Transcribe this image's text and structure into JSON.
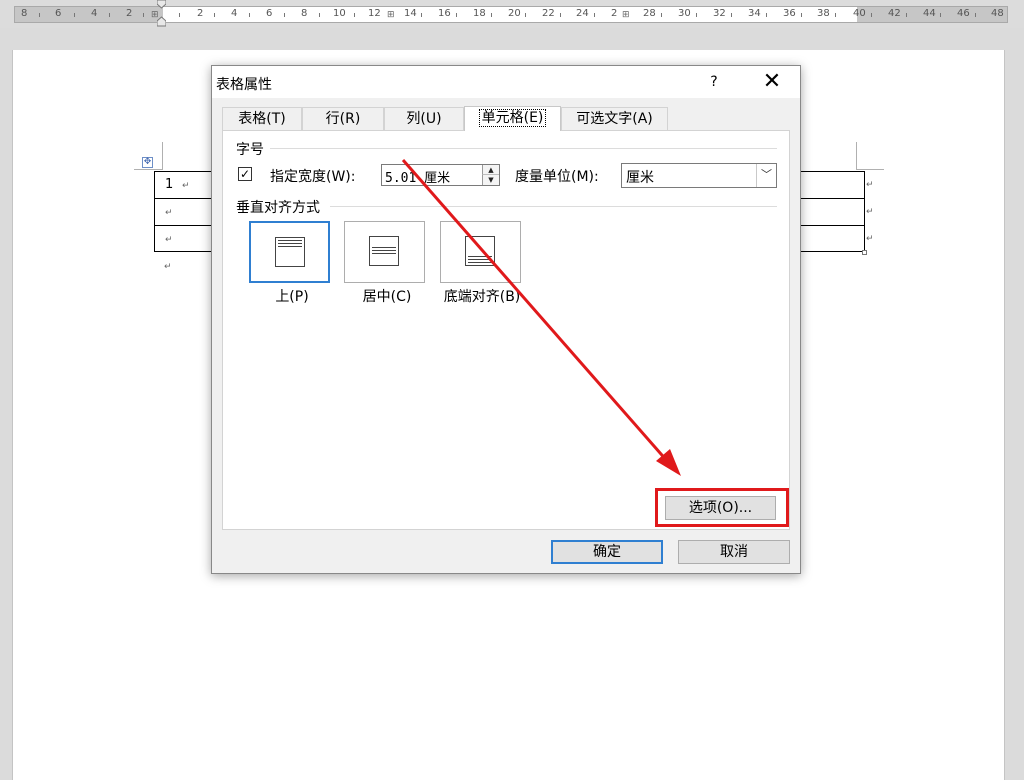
{
  "ruler": {
    "left_numbers": [
      "8",
      "6",
      "4",
      "2"
    ],
    "right_numbers": [
      "2",
      "4",
      "6",
      "8",
      "10",
      "12",
      "14",
      "16",
      "18",
      "20",
      "22",
      "24",
      "2",
      "28",
      "30",
      "32",
      "34",
      "36",
      "38",
      "40",
      "42",
      "44",
      "46",
      "48"
    ],
    "markers": [
      "⊞",
      "⊞",
      "⊞"
    ]
  },
  "document": {
    "cell_text": "1",
    "para_mark": "↵"
  },
  "dialog": {
    "title": "表格属性",
    "help": "?",
    "close": "✕",
    "tabs": [
      {
        "label": "表格(T)"
      },
      {
        "label": "行(R)"
      },
      {
        "label": "列(U)"
      },
      {
        "label": "单元格(E)"
      },
      {
        "label": "可选文字(A)"
      }
    ],
    "size_section": "字号",
    "specify_width": {
      "checked": "✓",
      "label": "指定宽度(W):",
      "value": "5.01 厘米"
    },
    "measure_unit": {
      "label": "度量单位(M):",
      "value": "厘米",
      "arrow": "﹀"
    },
    "valign_section": "垂直对齐方式",
    "valign_options": [
      {
        "label": "上(P)"
      },
      {
        "label": "居中(C)"
      },
      {
        "label": "底端对齐(B)"
      }
    ],
    "options_button": "选项(O)...",
    "ok_button": "确定",
    "cancel_button": "取消"
  },
  "annotation": {
    "color": "#e0191b"
  }
}
